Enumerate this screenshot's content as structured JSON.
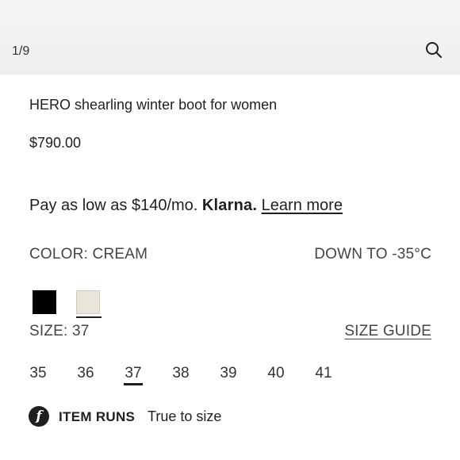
{
  "header": {
    "image_counter": "1/9",
    "search_icon": "search-icon"
  },
  "product": {
    "title": "HERO shearling winter boot for women",
    "price": "$790.00"
  },
  "financing": {
    "prefix": "Pay as low as $140/mo.",
    "provider": "Klarna.",
    "link_label": "Learn more"
  },
  "color": {
    "label": "COLOR: CREAM",
    "temperature_note": "DOWN TO -35°C",
    "swatches": [
      {
        "name": "black",
        "hex": "#000000",
        "selected": false
      },
      {
        "name": "cream",
        "hex": "#e8e6da",
        "selected": true
      }
    ]
  },
  "size": {
    "label": "SIZE: 37",
    "guide_label": "SIZE GUIDE",
    "options": [
      "35",
      "36",
      "37",
      "38",
      "39",
      "40",
      "41"
    ],
    "selected": "37"
  },
  "fit": {
    "icon": "fit-info-icon",
    "heading": "ITEM RUNS",
    "value": "True to size"
  }
}
